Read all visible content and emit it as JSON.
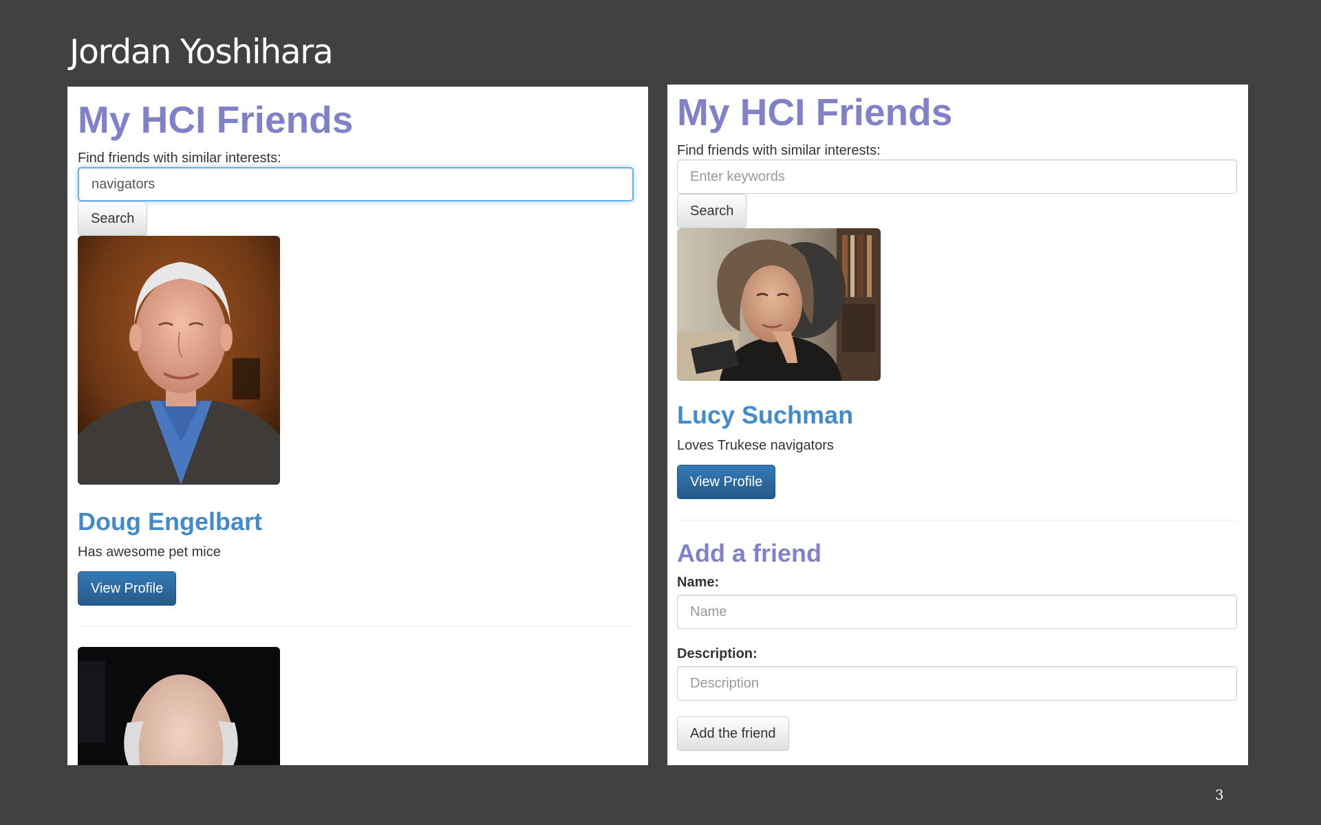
{
  "slide": {
    "title": "Jordan Yoshihara",
    "page_number": "3"
  },
  "left_panel": {
    "app_title": "My HCI Friends",
    "search": {
      "label": "Find friends with similar interests:",
      "value": "navigators",
      "button_label": "Search"
    },
    "friends": [
      {
        "name": "Doug Engelbart",
        "description": "Has awesome pet mice",
        "button_label": "View Profile",
        "photo": "portrait-older-man-blue-shirt"
      },
      {
        "photo": "portrait-bald-man-dark-background"
      }
    ]
  },
  "right_panel": {
    "app_title": "My HCI Friends",
    "search": {
      "label": "Find friends with similar interests:",
      "placeholder": "Enter keywords",
      "button_label": "Search"
    },
    "friends": [
      {
        "name": "Lucy Suchman",
        "description": "Loves Trukese navigators",
        "button_label": "View Profile",
        "photo": "portrait-woman-hand-on-chin"
      }
    ],
    "add_friend": {
      "title": "Add a friend",
      "name_label": "Name:",
      "name_placeholder": "Name",
      "description_label": "Description:",
      "description_placeholder": "Description",
      "button_label": "Add the friend"
    }
  },
  "colors": {
    "slide_background": "#414141",
    "app_title": "#8181c9",
    "friend_name": "#428bca",
    "primary_button": "#2e6da4",
    "focus_border": "#66afe9"
  }
}
